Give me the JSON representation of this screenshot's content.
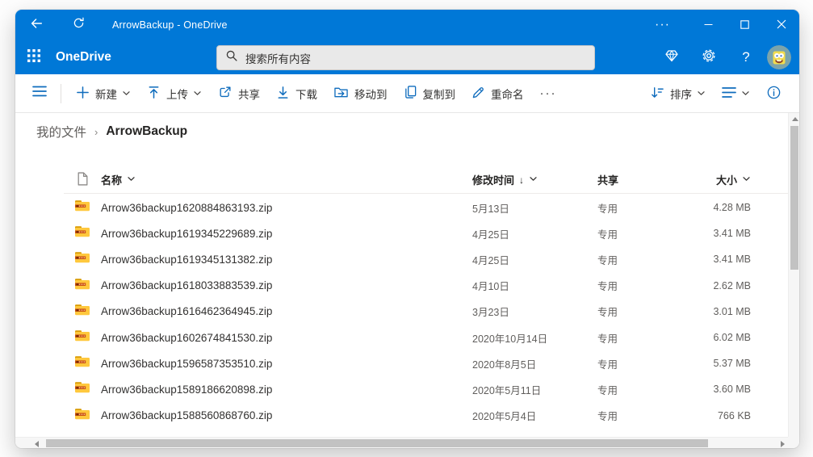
{
  "titlebar": {
    "title": "ArrowBackup - OneDrive",
    "more_glyph": "···"
  },
  "header": {
    "app_name": "OneDrive",
    "search_placeholder": "搜索所有内容",
    "help_label": "?"
  },
  "toolbar": {
    "items": [
      {
        "icon": "plus-icon",
        "label": "新建",
        "has_chevron": true
      },
      {
        "icon": "upload-icon",
        "label": "上传",
        "has_chevron": true
      },
      {
        "icon": "share-icon",
        "label": "共享",
        "has_chevron": false
      },
      {
        "icon": "download-icon",
        "label": "下载",
        "has_chevron": false
      },
      {
        "icon": "move-to-icon",
        "label": "移动到",
        "has_chevron": false
      },
      {
        "icon": "copy-to-icon",
        "label": "复制到",
        "has_chevron": false
      },
      {
        "icon": "rename-icon",
        "label": "重命名",
        "has_chevron": false
      }
    ],
    "overflow_glyph": "···",
    "sort_label": "排序"
  },
  "breadcrumb": {
    "parent": "我的文件",
    "separator": "›",
    "current": "ArrowBackup"
  },
  "table": {
    "headers": {
      "name": "名称",
      "modified": "修改时间",
      "modified_sort_indicator": "↓",
      "shared": "共享",
      "size": "大小"
    },
    "rows": [
      {
        "name": "Arrow36backup1620884863193.zip",
        "modified": "5月13日",
        "shared": "专用",
        "size": "4.28 MB"
      },
      {
        "name": "Arrow36backup1619345229689.zip",
        "modified": "4月25日",
        "shared": "专用",
        "size": "3.41 MB"
      },
      {
        "name": "Arrow36backup1619345131382.zip",
        "modified": "4月25日",
        "shared": "专用",
        "size": "3.41 MB"
      },
      {
        "name": "Arrow36backup1618033883539.zip",
        "modified": "4月10日",
        "shared": "专用",
        "size": "2.62 MB"
      },
      {
        "name": "Arrow36backup1616462364945.zip",
        "modified": "3月23日",
        "shared": "专用",
        "size": "3.01 MB"
      },
      {
        "name": "Arrow36backup1602674841530.zip",
        "modified": "2020年10月14日",
        "shared": "专用",
        "size": "6.02 MB"
      },
      {
        "name": "Arrow36backup1596587353510.zip",
        "modified": "2020年8月5日",
        "shared": "专用",
        "size": "5.37 MB"
      },
      {
        "name": "Arrow36backup1589186620898.zip",
        "modified": "2020年5月11日",
        "shared": "专用",
        "size": "3.60 MB"
      },
      {
        "name": "Arrow36backup1588560868760.zip",
        "modified": "2020年5月4日",
        "shared": "专用",
        "size": "766 KB"
      }
    ]
  },
  "icons": {
    "back-icon": "←",
    "refresh-icon": "⟳",
    "minimize-icon": "─",
    "maximize-icon": "□",
    "close-icon": "✕",
    "waffle-icon": "app launcher",
    "search-icon": "magnifier",
    "premium-icon": "diamond",
    "settings-icon": "gear",
    "help-icon": "?",
    "zip-folder-icon": "yellow zipped folder",
    "document-icon": "page",
    "sort-icon": "arrow-down with lines",
    "view-icon": "list lines",
    "info-icon": "i in circle"
  },
  "colors": {
    "accent_blue": "#0078d7",
    "toolbar_icon_blue": "#0f6cbd",
    "text_dark": "#323130",
    "text_gray": "#605e5c",
    "zip_folder_yellow": "#ffc83d",
    "zip_band_orange": "#ca5010"
  }
}
